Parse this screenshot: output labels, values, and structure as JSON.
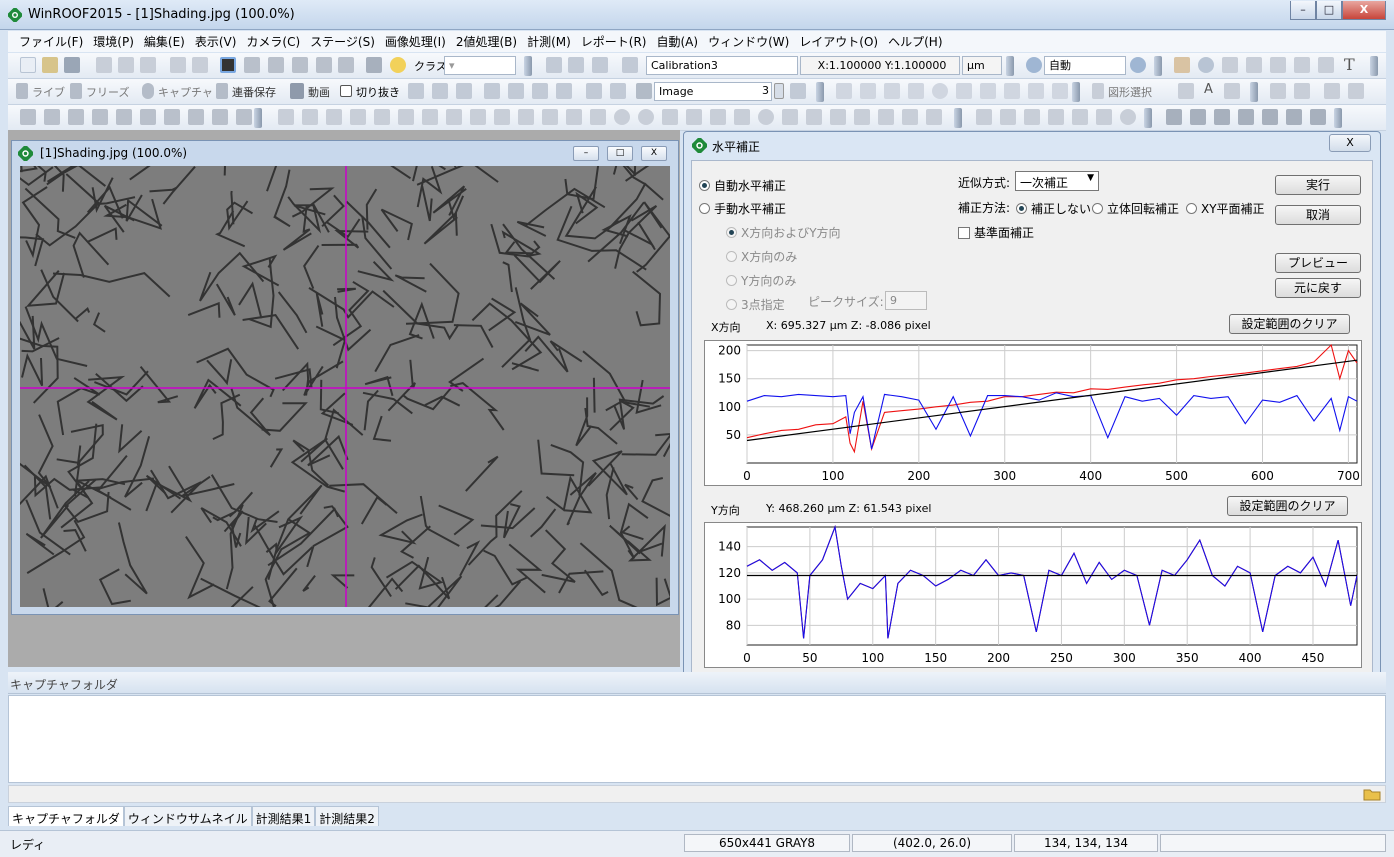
{
  "app": {
    "title": "WinROOF2015 - [1]Shading.jpg (100.0%)",
    "min": "–",
    "max": "□",
    "close": "X"
  },
  "menu": [
    "ファイル(F)",
    "環境(P)",
    "編集(E)",
    "表示(V)",
    "カメラ(C)",
    "ステージ(S)",
    "画像処理(I)",
    "2値処理(B)",
    "計測(M)",
    "レポート(R)",
    "自動(A)",
    "ウィンドウ(W)",
    "レイアウト(O)",
    "ヘルプ(H)"
  ],
  "toolbar1": {
    "class_label": "クラス",
    "calibration": "Calibration3",
    "scale": "X:1.100000 Y:1.100000",
    "unit": "μm",
    "zoom": "自動",
    "text_tool": "T"
  },
  "toolbar2": {
    "live": "ライブ",
    "freeze": "フリーズ",
    "capture": "キャプチャ",
    "seq_save": "連番保存",
    "movie": "動画",
    "crop": "切り抜き",
    "image_combo": "Image",
    "image_num": "3",
    "shape_select": "図形選択",
    "text_a": "A"
  },
  "image_window": {
    "title": "[1]Shading.jpg (100.0%)",
    "min": "–",
    "max": "□",
    "close": "X"
  },
  "dialog": {
    "title": "水平補正",
    "close": "X",
    "auto": "自動水平補正",
    "manual": "手動水平補正",
    "xy_both": "X方向およびY方向",
    "x_only": "X方向のみ",
    "y_only": "Y方向のみ",
    "three_point": "3点指定",
    "peak_label": "ピークサイズ:",
    "peak_value": "9",
    "approx_label": "近似方式:",
    "approx_value": "一次補正",
    "method_label": "補正方法:",
    "method_none": "補正しない",
    "method_3d": "立体回転補正",
    "method_xy": "XY平面補正",
    "ref_plane": "基準面補正",
    "run": "実行",
    "cancel": "取消",
    "preview": "プレビュー",
    "restore": "元に戻す",
    "x_title": "X方向",
    "x_readout": "X:  695.327  μm    Z:  -8.086  pixel",
    "y_title": "Y方向",
    "y_readout": "Y:  468.260  μm    Z:   61.543  pixel",
    "clear_range": "設定範囲のクリア"
  },
  "capture": {
    "label": "キャプチャフォルダ",
    "folder_icon": "folder-icon"
  },
  "tabs": [
    "キャプチャフォルダ",
    "ウィンドウサムネイル",
    "計測結果1",
    "計測結果2"
  ],
  "status": {
    "ready": "レディ",
    "size": "650x441 GRAY8",
    "coords": "(402.0, 26.0)",
    "value": "134, 134, 134"
  },
  "colors": {
    "red": "#ee1111",
    "blue": "#1111ee",
    "purple": "#5a1fb8",
    "magenta": "#cc00cc",
    "grid": "#cccccc"
  },
  "chart_data": [
    {
      "type": "line",
      "xlim": [
        0,
        710
      ],
      "ylim": [
        0,
        210
      ],
      "x_ticks": [
        0,
        100,
        200,
        300,
        400,
        500,
        600,
        700
      ],
      "y_ticks": [
        50,
        100,
        150,
        200
      ],
      "series": [
        {
          "color": "#ee1111",
          "x": [
            0,
            20,
            40,
            60,
            80,
            100,
            115,
            120,
            125,
            135,
            145,
            160,
            180,
            200,
            220,
            240,
            260,
            280,
            300,
            320,
            340,
            360,
            380,
            400,
            420,
            440,
            460,
            480,
            500,
            520,
            540,
            560,
            580,
            600,
            620,
            640,
            660,
            680,
            690,
            700,
            710
          ],
          "values": [
            45,
            52,
            58,
            60,
            68,
            70,
            82,
            35,
            20,
            110,
            25,
            90,
            93,
            96,
            100,
            103,
            108,
            110,
            118,
            118,
            122,
            126,
            125,
            132,
            131,
            135,
            139,
            142,
            148,
            150,
            154,
            157,
            160,
            164,
            168,
            172,
            180,
            210,
            150,
            200,
            178
          ]
        },
        {
          "color": "#1111ee",
          "x": [
            0,
            20,
            40,
            60,
            80,
            100,
            115,
            120,
            125,
            135,
            145,
            160,
            180,
            200,
            220,
            240,
            260,
            280,
            300,
            320,
            340,
            360,
            380,
            400,
            420,
            440,
            460,
            480,
            500,
            520,
            540,
            560,
            580,
            600,
            620,
            640,
            660,
            680,
            690,
            700,
            710
          ],
          "values": [
            110,
            120,
            118,
            122,
            120,
            118,
            120,
            52,
            90,
            118,
            25,
            122,
            118,
            112,
            60,
            118,
            48,
            120,
            120,
            118,
            112,
            125,
            118,
            120,
            45,
            118,
            110,
            115,
            85,
            120,
            115,
            118,
            70,
            112,
            108,
            120,
            75,
            115,
            58,
            118,
            110
          ]
        },
        {
          "color": "#000000",
          "x": [
            0,
            710
          ],
          "values": [
            40,
            183
          ]
        }
      ]
    },
    {
      "type": "line",
      "xlim": [
        0,
        485
      ],
      "ylim": [
        65,
        155
      ],
      "x_ticks": [
        0,
        50,
        100,
        150,
        200,
        250,
        300,
        350,
        400,
        450
      ],
      "y_ticks": [
        80,
        100,
        120,
        140
      ],
      "series": [
        {
          "color": "#ee1111",
          "x": [
            0,
            10,
            20,
            30,
            40,
            45,
            50,
            60,
            70,
            75,
            80,
            90,
            100,
            110,
            112,
            120,
            130,
            140,
            150,
            160,
            170,
            180,
            190,
            200,
            210,
            220,
            230,
            240,
            250,
            260,
            270,
            280,
            290,
            300,
            310,
            320,
            330,
            340,
            350,
            360,
            370,
            380,
            390,
            400,
            410,
            420,
            430,
            440,
            450,
            460,
            470,
            480,
            485
          ],
          "values": [
            125,
            130,
            122,
            128,
            120,
            70,
            118,
            130,
            155,
            125,
            100,
            112,
            108,
            118,
            70,
            112,
            122,
            118,
            110,
            115,
            122,
            118,
            130,
            118,
            120,
            118,
            75,
            122,
            118,
            135,
            112,
            128,
            115,
            122,
            118,
            80,
            122,
            118,
            130,
            145,
            118,
            110,
            125,
            120,
            75,
            118,
            125,
            120,
            132,
            110,
            145,
            95,
            118
          ]
        },
        {
          "color": "#1111ee",
          "x": [
            0,
            10,
            20,
            30,
            40,
            45,
            50,
            60,
            70,
            75,
            80,
            90,
            100,
            110,
            112,
            120,
            130,
            140,
            150,
            160,
            170,
            180,
            190,
            200,
            210,
            220,
            230,
            240,
            250,
            260,
            270,
            280,
            290,
            300,
            310,
            320,
            330,
            340,
            350,
            360,
            370,
            380,
            390,
            400,
            410,
            420,
            430,
            440,
            450,
            460,
            470,
            480,
            485
          ],
          "values": [
            125,
            130,
            122,
            128,
            120,
            70,
            118,
            130,
            155,
            125,
            100,
            112,
            108,
            118,
            70,
            112,
            122,
            118,
            110,
            115,
            122,
            118,
            130,
            118,
            120,
            118,
            75,
            122,
            118,
            135,
            112,
            128,
            115,
            122,
            118,
            80,
            122,
            118,
            130,
            145,
            118,
            110,
            125,
            120,
            75,
            118,
            125,
            120,
            132,
            110,
            145,
            95,
            118
          ]
        },
        {
          "color": "#000000",
          "x": [
            0,
            485
          ],
          "values": [
            118,
            118
          ]
        }
      ]
    }
  ]
}
